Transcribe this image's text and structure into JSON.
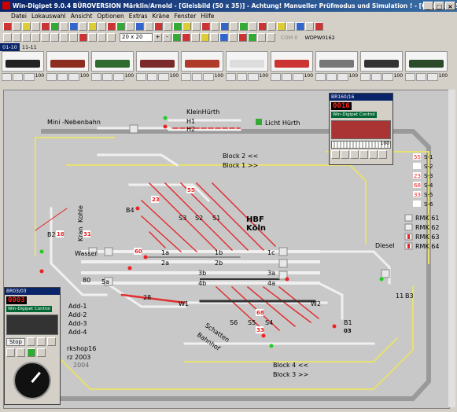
{
  "window": {
    "title": "Win-Digipet 9.0.4 BÜROVERSION  Märklin/Arnold - [Gleisbild (50 x 35)] - Achtung! Manueller Prüfmodus und Simulation ! - [Gleisbild (50 x 35)]"
  },
  "menu": [
    "Datei",
    "Lokauswahl",
    "Ansicht",
    "Optionen",
    "Extras",
    "Kräne",
    "Fenster",
    "Hilfe"
  ],
  "toolbar": {
    "zoom": "20 x 20",
    "com": "COM 0",
    "wdp": "WDPW0162"
  },
  "tabs": [
    "01-10",
    "11-11"
  ],
  "locos": [
    {
      "color": "#222"
    },
    {
      "color": "#8b2c1f"
    },
    {
      "color": "#2f6b2f"
    },
    {
      "color": "#7a2a2a"
    },
    {
      "color": "#b03a2a"
    },
    {
      "color": "#ddd"
    },
    {
      "color": "#c33"
    },
    {
      "color": "#777"
    },
    {
      "color": "#333"
    },
    {
      "color": "#2a4a2a"
    }
  ],
  "speed_values": [
    "100",
    "100",
    "100",
    "100",
    "100",
    "100",
    "100",
    "100",
    "100",
    "100"
  ],
  "layout": {
    "label_mini": "Mini -Nebenbahn",
    "label_kleinhuerth": "KleinHürth",
    "h1": "H1",
    "h2": "H2",
    "licht": "Licht Hürth",
    "block2": "Block 2 <<",
    "block1": "Block 1 >>",
    "block4": "Block 4 <<",
    "block3": "Block 3 >>",
    "hbf1": "HBF",
    "hbf2": "Köln",
    "b4": "B4",
    "b2": "B2",
    "b3": "B3",
    "b1": "B1",
    "n11": "11",
    "s3": "S3",
    "s2": "S2",
    "s1": "S1",
    "s6": "S6",
    "s5": "S5",
    "s4": "S4",
    "kohle": "Kohle",
    "kran": "Kran",
    "wasser": "Wasser",
    "diesel": "Diesel",
    "t1a": "1a",
    "t1b": "1b",
    "t1c": "1c",
    "t2a": "2a",
    "t2b": "2b",
    "t3a": "3a",
    "t3b": "3b",
    "t4a": "4a",
    "t4b": "4b",
    "n5a": "5a",
    "n80": "80",
    "n28": "28",
    "w1": "W1",
    "w2": "W2",
    "schatten1": "Schatten",
    "schatten2": "Bahnhof",
    "add1": "Add-1",
    "add2": "Add-2",
    "add3": "Add-3",
    "add4": "Add-4",
    "workshop": "rkshop16",
    "year": "rz 2003",
    "year2": "2004",
    "red_badges": [
      "16",
      "31",
      "23",
      "55",
      "60",
      "68",
      "33",
      "03"
    ],
    "s_list": [
      {
        "num": "55",
        "label": "S-1"
      },
      {
        "num": "",
        "label": "S-2"
      },
      {
        "num": "23",
        "label": "S-3"
      },
      {
        "num": "68",
        "label": "S-4"
      },
      {
        "num": "33",
        "label": "S-5"
      },
      {
        "num": "",
        "label": "S-6"
      }
    ],
    "rmk": [
      "RMK 61",
      "RMK 62",
      "RMK 63",
      "RMK 64"
    ]
  },
  "controller_top": {
    "title": "BR160/16",
    "digits": "0016",
    "brand": "Win-Digipet Control",
    "speed": "100"
  },
  "controller_left": {
    "title": "BR03/03",
    "digits": "0003",
    "brand": "Win-Digipet Control",
    "stop": "Stop"
  }
}
